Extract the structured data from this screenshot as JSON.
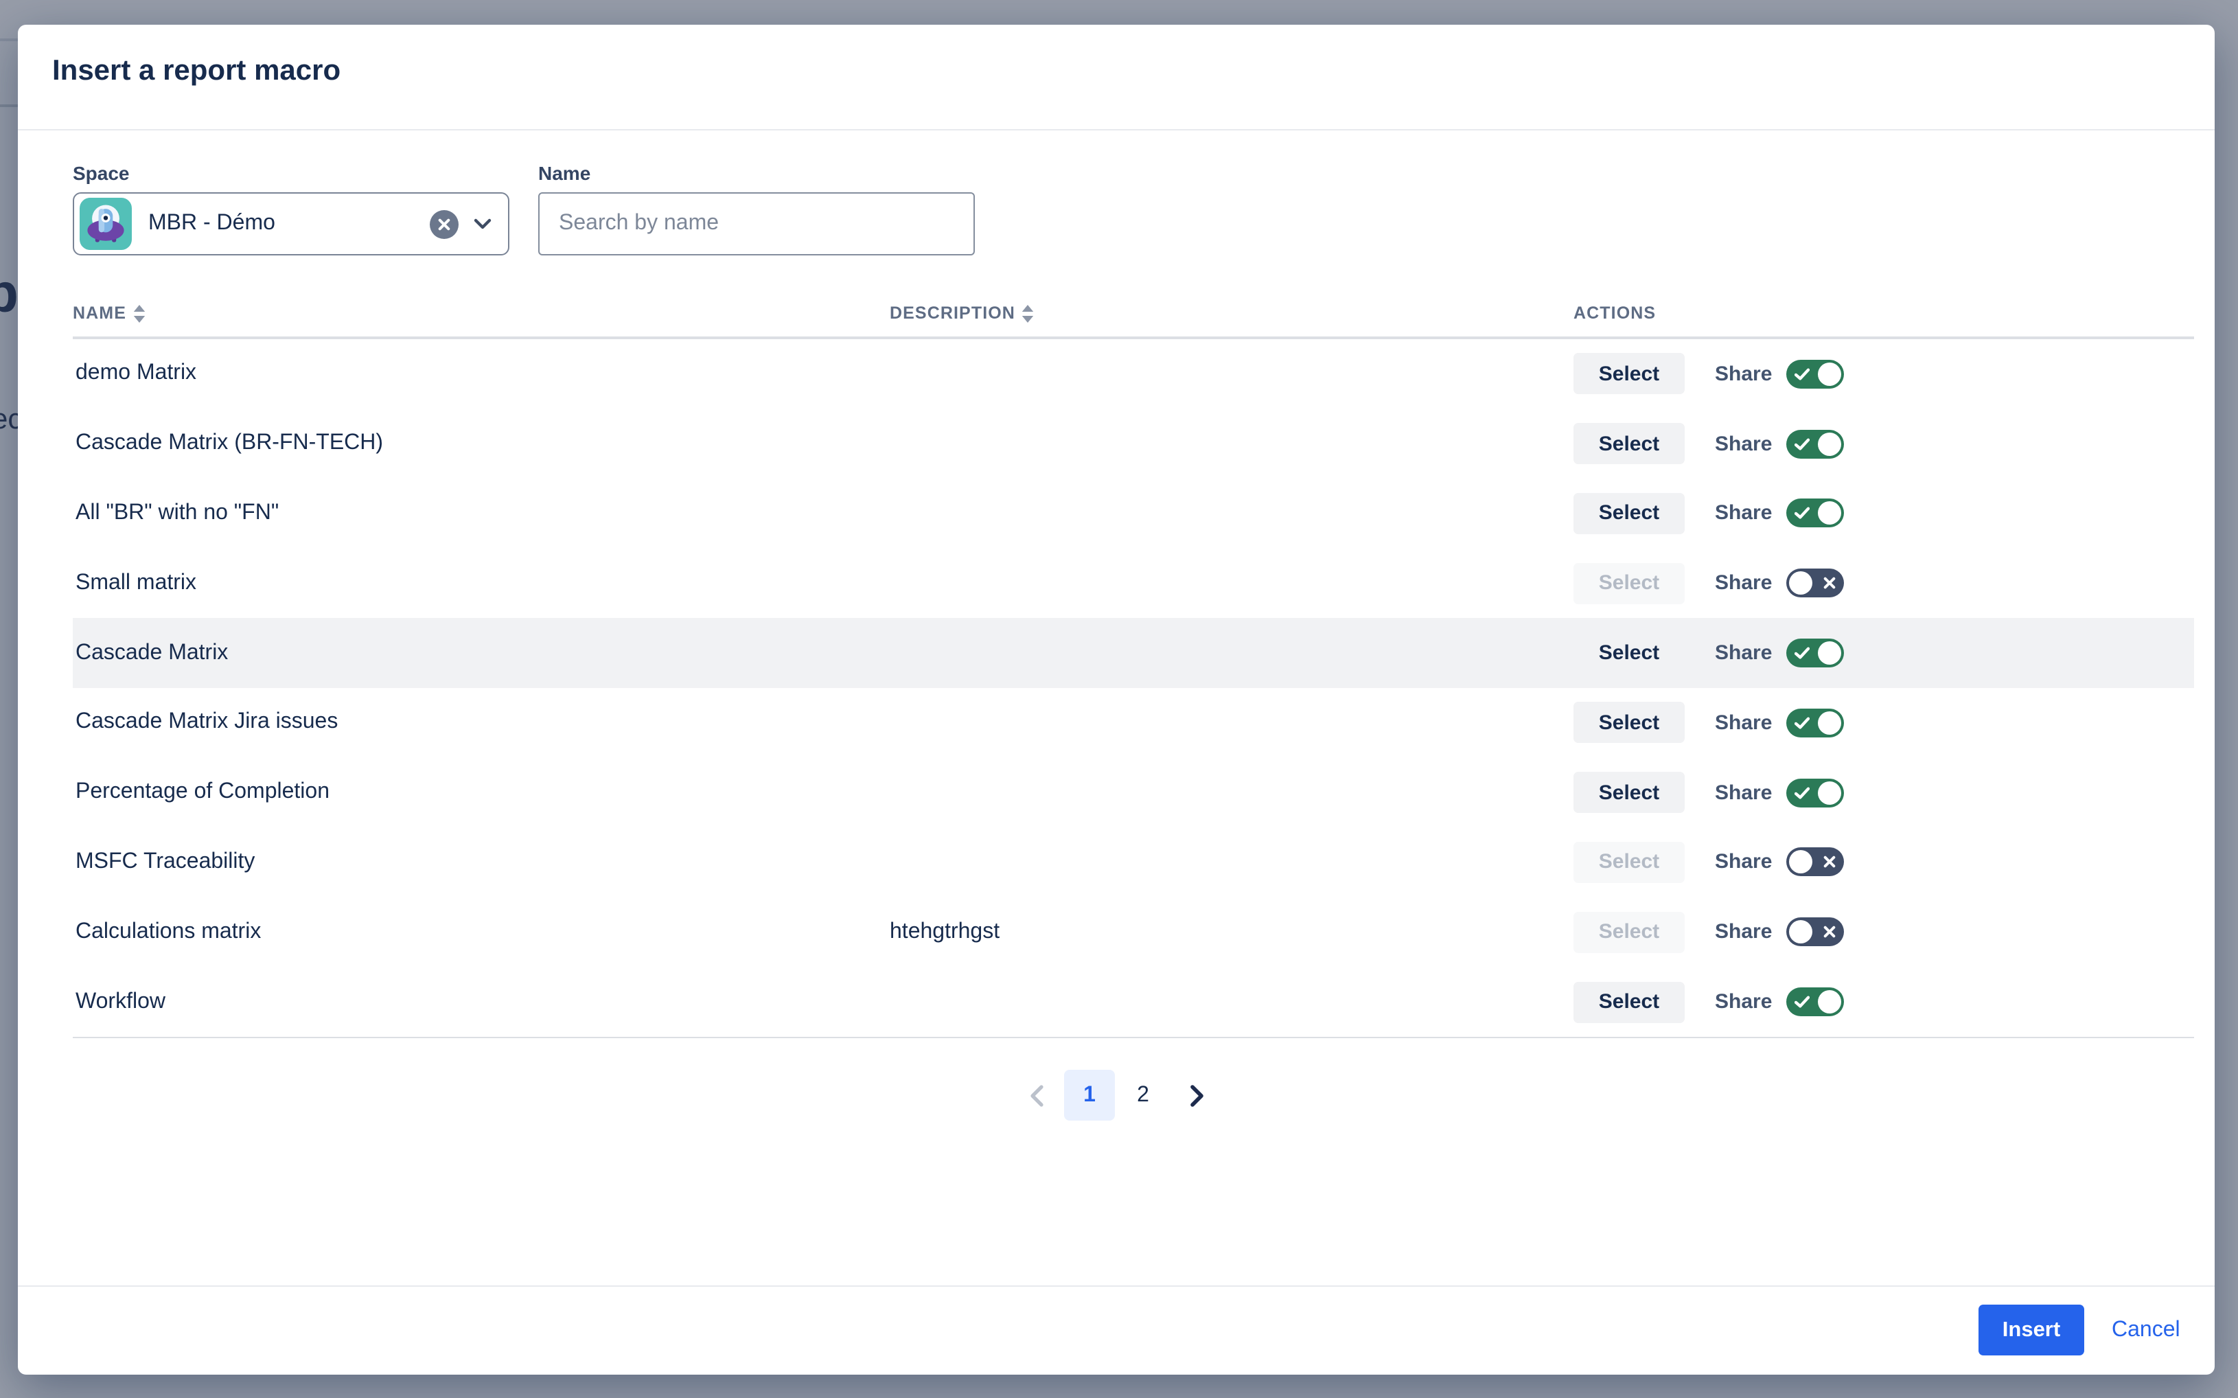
{
  "backdrop": {
    "fragments": {
      "letter_p": "p",
      "letters_ec": "ec"
    }
  },
  "modal": {
    "title": "Insert a report macro",
    "space": {
      "label": "Space",
      "value": "MBR - Démo"
    },
    "search": {
      "label": "Name",
      "placeholder": "Search by name"
    },
    "table": {
      "columns": [
        {
          "label": "NAME",
          "sortable": true
        },
        {
          "label": "DESCRIPTION",
          "sortable": true
        },
        {
          "label": "ACTIONS",
          "sortable": false
        }
      ],
      "select_label": "Select",
      "share_label": "Share",
      "rows": [
        {
          "name": "demo Matrix",
          "description": "",
          "select_enabled": true,
          "share_on": true,
          "highlighted": false
        },
        {
          "name": "Cascade Matrix (BR-FN-TECH)",
          "description": "",
          "select_enabled": true,
          "share_on": true,
          "highlighted": false
        },
        {
          "name": "All \"BR\" with no \"FN\"",
          "description": "",
          "select_enabled": true,
          "share_on": true,
          "highlighted": false
        },
        {
          "name": "Small matrix",
          "description": "",
          "select_enabled": false,
          "share_on": false,
          "highlighted": false
        },
        {
          "name": "Cascade Matrix",
          "description": "",
          "select_enabled": true,
          "share_on": true,
          "highlighted": true
        },
        {
          "name": "Cascade Matrix Jira issues",
          "description": "",
          "select_enabled": true,
          "share_on": true,
          "highlighted": false
        },
        {
          "name": "Percentage of Completion",
          "description": "",
          "select_enabled": true,
          "share_on": true,
          "highlighted": false
        },
        {
          "name": "MSFC Traceability",
          "description": "",
          "select_enabled": false,
          "share_on": false,
          "highlighted": false
        },
        {
          "name": "Calculations matrix",
          "description": "htehgtrhgst",
          "select_enabled": false,
          "share_on": false,
          "highlighted": false
        },
        {
          "name": "Workflow",
          "description": "",
          "select_enabled": true,
          "share_on": true,
          "highlighted": false
        }
      ]
    },
    "pagination": {
      "pages": [
        "1",
        "2"
      ],
      "current": "1",
      "has_prev": false,
      "has_next": true
    },
    "footer": {
      "insert_label": "Insert",
      "cancel_label": "Cancel"
    }
  },
  "colors": {
    "accent": "#2563EB",
    "accent_light_bg": "#E9F0FE",
    "toggle_on": "#2B7A57",
    "toggle_off": "#414E68",
    "select_bg": "#F1F2F4",
    "select_disabled_bg": "#F7F8F9",
    "select_disabled_text": "#B3BAC5",
    "text_primary": "#172B4D",
    "text_label": "#344563",
    "text_share": "#44546F",
    "text_header": "#5E6C84",
    "placeholder": "#7D8798",
    "line": "#DCDFE4",
    "divider": "#E8EAEE",
    "field_border": "#7A8496",
    "input_border": "#848E9E",
    "row_hover": "#F1F2F4",
    "backdrop": "#979DA9",
    "pag_disabled": "#BBC1CB",
    "clear_grey": "#6B778C",
    "avatar_teal": "#53C0B8",
    "avatar_purple": "#6C44A8",
    "avatar_blue": "#7FB5E6",
    "avatar_navy": "#152747"
  }
}
